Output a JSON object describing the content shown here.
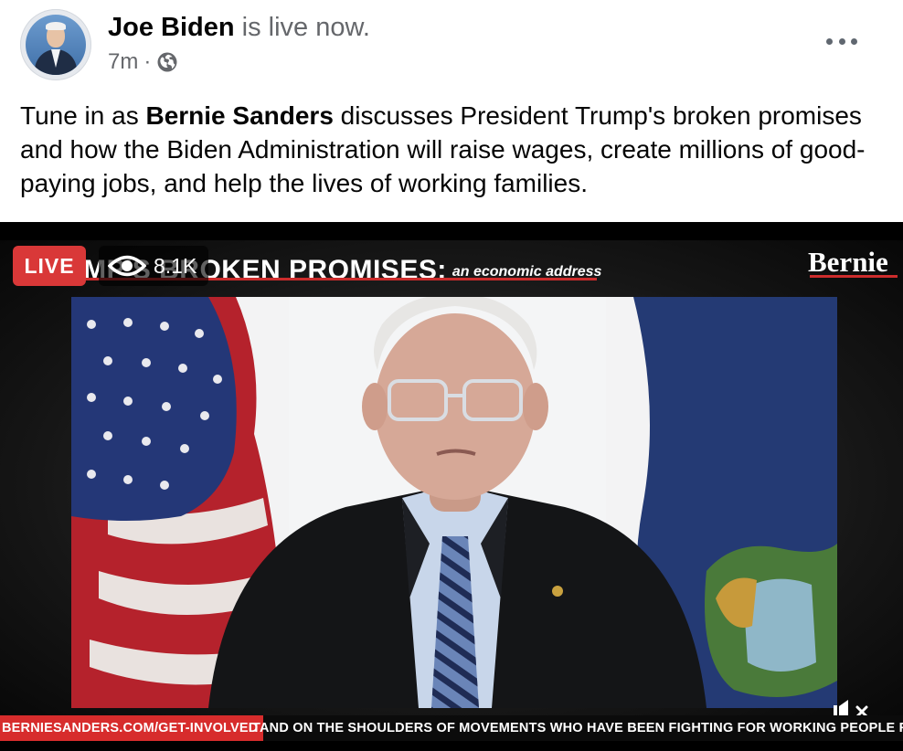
{
  "post": {
    "author": "Joe Biden",
    "status": "is live now.",
    "time": "7m",
    "separator": "·",
    "audience_icon": "globe-icon",
    "more_icon": "more-horizontal-icon",
    "text_before": "Tune in as ",
    "text_bold": "Bernie Sanders",
    "text_after": " discusses President Trump's broken promises and how the Biden Administration will raise wages, create millions of good-paying jobs, and help the lives of working families."
  },
  "video": {
    "title": "TRUMP'S BROKEN PROMISES:",
    "subtitle": "an economic address",
    "logo": "Bernie",
    "live_label": "LIVE",
    "viewer_count": "8.1K",
    "viewer_icon": "eye-icon",
    "mute_icon": "muted-speaker-icon",
    "ticker_link": "BERNIESANDERS.COM/GET-INVOLVED",
    "ticker_text": "TAND ON THE SHOULDERS OF MOVEMENTS WHO HAVE BEEN FIGHTING FOR WORKING PEOPLE FOR GEN"
  },
  "colors": {
    "live_red": "#d93838",
    "accent_red": "#cc2c2c",
    "secondary_text": "#65676b"
  }
}
